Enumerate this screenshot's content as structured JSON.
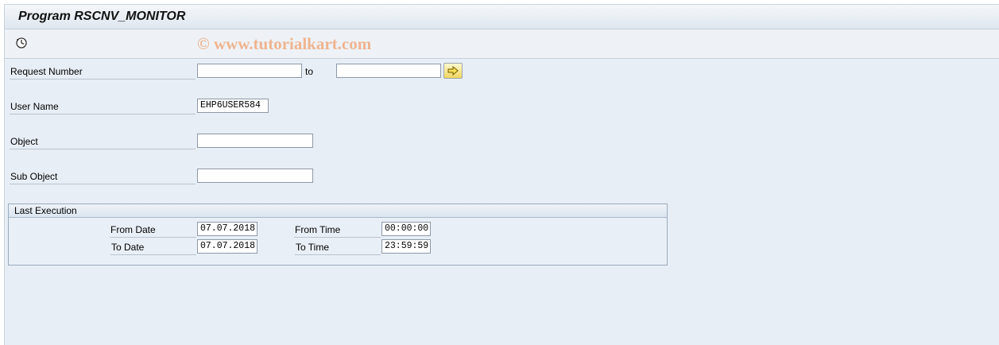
{
  "window": {
    "title": "Program RSCNV_MONITOR"
  },
  "toolbar": {
    "execute_icon": "clock-execute-icon",
    "watermark": "© www.tutorialkart.com"
  },
  "form": {
    "request_number": {
      "label": "Request Number",
      "from_value": "",
      "to_label": "to",
      "to_value": "",
      "multiple_selection_icon": "arrow-right-icon"
    },
    "user_name": {
      "label": "User Name",
      "value": "EHP6USER584"
    },
    "object": {
      "label": "Object",
      "value": ""
    },
    "sub_object": {
      "label": "Sub Object",
      "value": ""
    }
  },
  "last_execution": {
    "title": "Last Execution",
    "from_date": {
      "label": "From Date",
      "value": "07.07.2018"
    },
    "to_date": {
      "label": "To Date",
      "value": "07.07.2018"
    },
    "from_time": {
      "label": "From Time",
      "value": "00:00:00"
    },
    "to_time": {
      "label": "To Time",
      "value": "23:59:59"
    }
  },
  "colors": {
    "background": "#e8eef5",
    "accent_button": "#f1d55e",
    "watermark": "#efb48f"
  }
}
